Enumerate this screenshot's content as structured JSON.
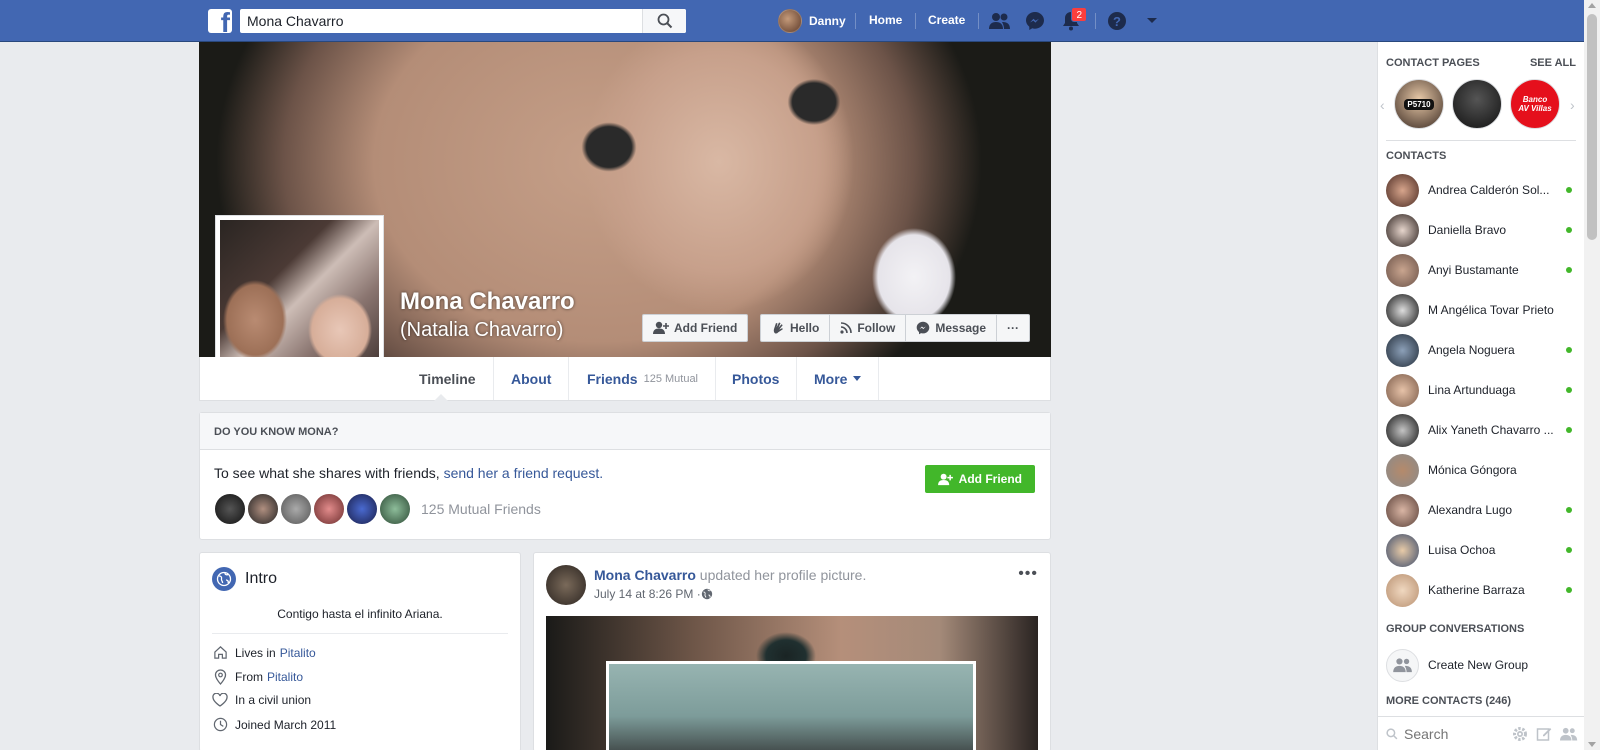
{
  "topbar": {
    "logo": "f",
    "search_value": "Mona Chavarro",
    "user_name": "Danny",
    "home": "Home",
    "create": "Create",
    "notifications_count": "2"
  },
  "profile": {
    "name": "Mona Chavarro",
    "alt_name": "(Natalia Chavarro)",
    "buttons": {
      "add_friend": "Add Friend",
      "hello": "Hello",
      "follow": "Follow",
      "message": "Message",
      "more": "···"
    },
    "tabs": {
      "timeline": "Timeline",
      "about": "About",
      "friends": "Friends",
      "friends_sub": "125 Mutual",
      "photos": "Photos",
      "more": "More"
    }
  },
  "know_card": {
    "heading": "DO YOU KNOW MONA?",
    "text": "To see what she shares with friends, ",
    "link": "send her a friend request.",
    "mutual": "125 Mutual Friends",
    "button": "Add Friend"
  },
  "intro": {
    "title": "Intro",
    "bio": "Contigo hasta el infinito Ariana.",
    "lives_label": "Lives in",
    "lives_place": "Pitalito",
    "from_label": "From",
    "from_place": "Pitalito",
    "relationship": "In a civil union",
    "joined": "Joined March 2011"
  },
  "post": {
    "author": "Mona Chavarro",
    "action": " updated her profile picture.",
    "time": "July 14 at 8:26 PM · ",
    "more": "•••"
  },
  "sidebar": {
    "contact_pages": "CONTACT PAGES",
    "see_all": "SEE ALL",
    "page_labels": [
      "P5710",
      "",
      "Banco AV Villas"
    ],
    "contacts_heading": "CONTACTS",
    "contacts": [
      "Andrea Calderón Sol...",
      "Daniella Bravo",
      "Anyi Bustamante",
      "M Angélica Tovar Prieto",
      "Angela Noguera",
      "Lina Artunduaga",
      "Alix Yaneth Chavarro ...",
      "Mónica Góngora",
      "Alexandra Lugo",
      "Luisa Ochoa",
      "Katherine Barraza"
    ],
    "group_heading": "GROUP CONVERSATIONS",
    "create_group": "Create New Group",
    "more_contacts": "MORE CONTACTS (246)",
    "search_placeholder": "Search"
  },
  "colors": {
    "brand_blue": "#4267b2",
    "link_blue": "#365899",
    "online_green": "#42b72a",
    "badge_red": "#fa3e3e"
  }
}
